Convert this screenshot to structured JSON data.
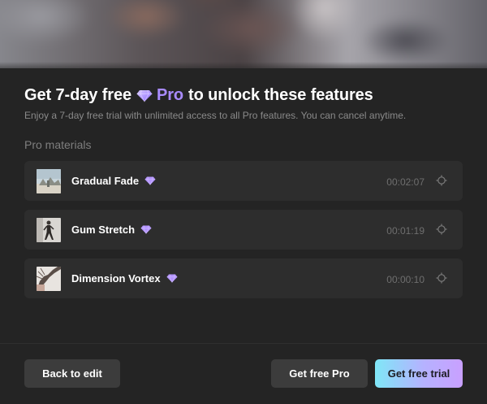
{
  "header": {
    "title_prefix": "Get 7-day free",
    "title_pro": "Pro",
    "title_suffix": "to unlock these features",
    "subtitle": "Enjoy a 7-day free trial with unlimited access to all Pro features. You can cancel anytime."
  },
  "section": {
    "label": "Pro materials"
  },
  "materials": [
    {
      "name": "Gradual Fade",
      "duration": "00:02:07",
      "icon": "diamond-icon"
    },
    {
      "name": "Gum Stretch",
      "duration": "00:01:19",
      "icon": "diamond-icon"
    },
    {
      "name": "Dimension Vortex",
      "duration": "00:00:10",
      "icon": "diamond-icon"
    }
  ],
  "footer": {
    "back_label": "Back to edit",
    "get_pro_label": "Get free Pro",
    "trial_label": "Get free trial"
  },
  "colors": {
    "accent": "#a98bff",
    "trial_gradient_start": "#7fe7f7",
    "trial_gradient_end": "#c9a0ff"
  }
}
